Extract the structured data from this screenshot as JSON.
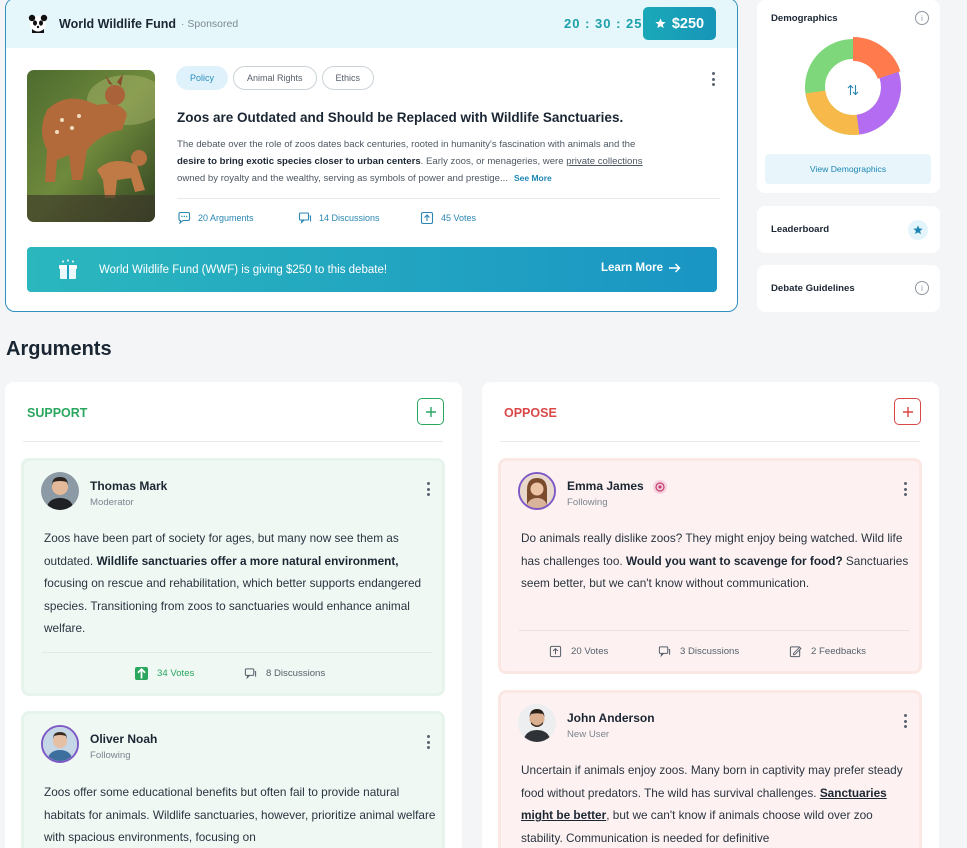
{
  "debate": {
    "sponsor_name": "World Wildlife Fund",
    "sponsor_tag": "· Sponsored",
    "timer": "20 : 30 : 25",
    "prize": "$250",
    "tags": [
      "Policy",
      "Animal Rights",
      "Ethics"
    ],
    "title": "Zoos are Outdated and Should be Replaced with Wildlife Sanctuaries.",
    "desc_1": "The debate over the role of zoos dates back centuries, rooted in humanity's fascination with animals and the",
    "desc_2_bold": "desire to bring exotic species closer to urban centers",
    "desc_2_rest": ". Early zoos, or menageries, were ",
    "desc_2_link": "private collections",
    "desc_3": "owned by royalty and the wealthy, serving as symbols of power and prestige...",
    "see_more": "See More",
    "arguments_count": "20 Arguments",
    "discussions_count": "14 Discussions",
    "votes_count": "45 Votes",
    "banner_text": "World Wildlife Fund (WWF) is giving $250 to this debate!",
    "learn_more": "Learn More"
  },
  "sidebar": {
    "demographics_title": "Demographics",
    "view_demographics": "View Demographics",
    "leaderboard_title": "Leaderboard",
    "guidelines_title": "Debate Guidelines",
    "donut_colors": [
      "#ff7a4d",
      "#b46cf2",
      "#f7b94a",
      "#7ed77a"
    ]
  },
  "arguments": {
    "heading": "Arguments",
    "support": {
      "label": "SUPPORT",
      "color": "#2aa65f",
      "cards": [
        {
          "name": "Thomas Mark",
          "role": "Moderator",
          "text_1": "Zoos have been part of society for ages, but many now see them as outdated. ",
          "text_bold": "Wildlife sanctuaries offer a more natural environment,",
          "text_2": " focusing on rescue and rehabilitation, which better supports endangered species. Transitioning from zoos to sanctuaries would enhance animal welfare.",
          "votes": "34 Votes",
          "discussions": "8 Discussions"
        },
        {
          "name": "Oliver Noah",
          "role": "Following",
          "text_1": "Zoos offer some educational benefits but often fail to provide natural habitats for animals. Wildlife sanctuaries, however, prioritize animal welfare with spacious environments, focusing on"
        }
      ]
    },
    "oppose": {
      "label": "OPPOSE",
      "color": "#d94848",
      "cards": [
        {
          "name": "Emma James",
          "role": "Following",
          "text_1": "Do animals really dislike zoos? They might enjoy being watched. Wild life has challenges too. ",
          "text_bold": "Would you want to scavenge for food?",
          "text_2": " Sanctuaries seem better, but we can't know without communication.",
          "votes": "20 Votes",
          "discussions": "3 Discussions",
          "feedbacks": "2 Feedbacks"
        },
        {
          "name": "John Anderson",
          "role": "New User",
          "text_1": "Uncertain if animals enjoy zoos. Many born in captivity may prefer steady food without predators. The wild has survival challenges. ",
          "text_link": "Sanctuaries might be better",
          "text_2": ", but we can't know if animals choose wild over zoo stability. Communication is needed for definitive"
        }
      ]
    }
  }
}
